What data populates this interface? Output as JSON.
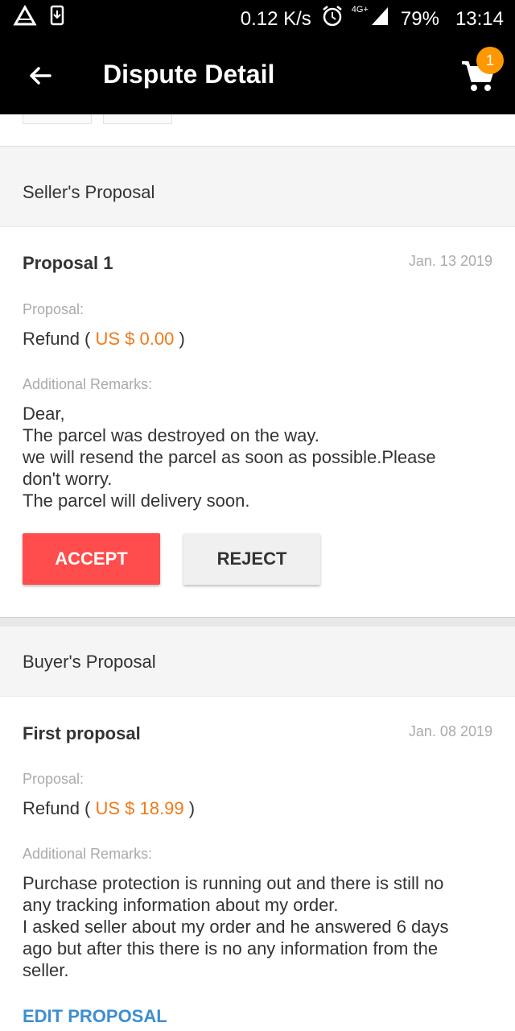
{
  "status_bar": {
    "speed": "0.12 K/s",
    "network": "4G+",
    "battery": "79%",
    "time": "13:14",
    "icons": [
      "warning-icon",
      "download-icon",
      "alarm-icon",
      "signal-icon"
    ]
  },
  "app_bar": {
    "title": "Dispute Detail",
    "cart_count": "1",
    "back_icon": "arrow-left-icon",
    "cart_icon": "cart-icon"
  },
  "sellers_section": {
    "header": "Seller's Proposal",
    "proposal_title": "Proposal 1",
    "date": "Jan. 13 2019",
    "proposal_label": "Proposal:",
    "refund_prefix": "Refund ( ",
    "amount": "US $ 0.00",
    "refund_suffix": " )",
    "remarks_label": "Additional Remarks:",
    "remarks_lines": [
      "Dear,",
      "The parcel was destroyed on the way.",
      "we will resend the parcel as soon as possible.Please",
      "don't worry.",
      "The parcel will delivery soon."
    ],
    "accept_label": "ACCEPT",
    "reject_label": "REJECT"
  },
  "buyers_section": {
    "header": "Buyer's Proposal",
    "proposal_title": "First proposal",
    "date": "Jan. 08 2019",
    "proposal_label": "Proposal:",
    "refund_prefix": "Refund ( ",
    "amount": "US $ 18.99",
    "refund_suffix": " )",
    "remarks_label": "Additional Remarks:",
    "remarks_lines": [
      "Purchase protection is running out and there is still no",
      "any tracking information about my order.",
      "I asked seller about my order and he answered 6 days",
      "ago but after this there is no any information from the",
      "seller."
    ],
    "edit_label": "EDIT PROPOSAL"
  },
  "colors": {
    "accent": "#ff4c4c",
    "amount": "#f07a1a",
    "link": "#3d8fd1",
    "badge": "#ff9800"
  }
}
